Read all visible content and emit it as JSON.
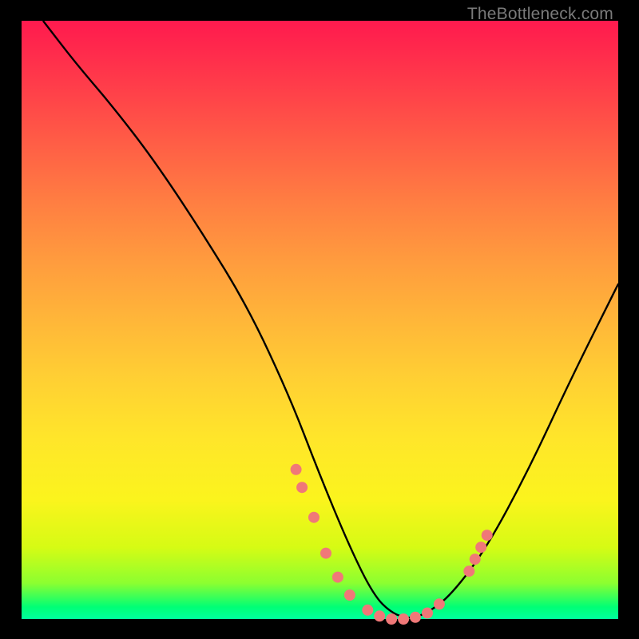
{
  "watermark": "TheBottleneck.com",
  "colors": {
    "background": "#000000",
    "curve_stroke": "#000000",
    "marker_fill": "#f07878",
    "watermark": "#7a7a7a"
  },
  "chart_data": {
    "type": "line",
    "title": "",
    "xlabel": "",
    "ylabel": "",
    "xlim": [
      0,
      100
    ],
    "ylim": [
      0,
      100
    ],
    "grid": false,
    "legend": false,
    "series": [
      {
        "name": "bottleneck-curve",
        "x": [
          3.6,
          9,
          15,
          22,
          30,
          38,
          45,
          50,
          55,
          59,
          62,
          65,
          68,
          72,
          78,
          85,
          92,
          100
        ],
        "values": [
          100,
          93,
          86,
          77,
          65,
          52,
          37,
          24,
          12,
          4,
          1,
          0,
          1,
          4,
          12,
          25,
          40,
          56
        ]
      }
    ],
    "markers": {
      "name": "highlighted-points",
      "color": "#f07878",
      "points": [
        {
          "x": 46,
          "y": 25
        },
        {
          "x": 47,
          "y": 22
        },
        {
          "x": 49,
          "y": 17
        },
        {
          "x": 51,
          "y": 11
        },
        {
          "x": 53,
          "y": 7
        },
        {
          "x": 55,
          "y": 4
        },
        {
          "x": 58,
          "y": 1.5
        },
        {
          "x": 60,
          "y": 0.5
        },
        {
          "x": 62,
          "y": 0
        },
        {
          "x": 64,
          "y": 0
        },
        {
          "x": 66,
          "y": 0.3
        },
        {
          "x": 68,
          "y": 1
        },
        {
          "x": 70,
          "y": 2.5
        },
        {
          "x": 75,
          "y": 8
        },
        {
          "x": 76,
          "y": 10
        },
        {
          "x": 77,
          "y": 12
        },
        {
          "x": 78,
          "y": 14
        }
      ]
    }
  }
}
